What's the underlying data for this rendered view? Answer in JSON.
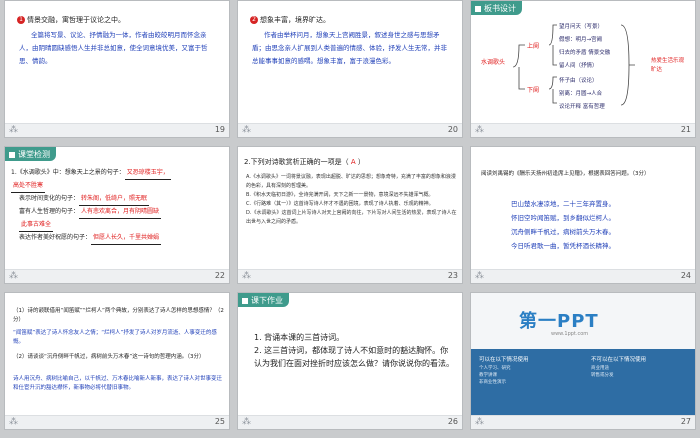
{
  "footer_star": "⁂",
  "slides": {
    "s19": {
      "num": "19",
      "heading_badge": "1",
      "heading": "情景交融，寓哲理于议论之中。",
      "body": "全篇将写景、议论、抒情融为一体，作者由皎皎明月而怀念亲人，由阴晴圆缺感悟人生并非总如意，使全词意境优美，又富于哲思、情韵。"
    },
    "s20": {
      "num": "20",
      "heading_badge": "2",
      "heading": "想象丰富，境界旷达。",
      "body": "作者由举杯问月，想象天上宫阙胜景，叙述身世之感与思想矛盾；由思念亲人扩展到人类普遍的情感、体验，抒发人生无常，并非总能事事如意的感喟。想象丰富，富于浪漫色彩。"
    },
    "s21": {
      "num": "21",
      "title": "板书设计",
      "root": "水调歌头",
      "upper": "上阕",
      "lower": "下阕",
      "upper_items": [
        "望月问天（写景）",
        "假想：明月→宫阙",
        "归去的矛盾  情景交融",
        "留人间（抒情）"
      ],
      "lower_items": [
        "怀子由（议论）",
        "别离：月圆→人合",
        "议论开释  富有哲理"
      ],
      "right": "热爱生活乐观旷达"
    },
    "s22": {
      "num": "22",
      "bar": "课堂检测",
      "q1_lead": "1.《水调歌头》中：想象天上之景的句子：",
      "q1_ans1": "又恐琼楼玉宇，",
      "q1_ans2": "高处不胜寒",
      "q2_lead": "表示时间变化的句子：",
      "q2_ans": "转朱阁，低绮户，照无眠",
      "q3_lead": "富有人生哲理的句子：",
      "q3_ans1": "人有悲欢离合，月有阴晴圆缺",
      "q3_ans2": "此事古难全",
      "q4_lead": "表达作者美好祝愿的句子：",
      "q4_ans": "但愿人长久，千里共婵娟"
    },
    "s23": {
      "num": "23",
      "question": "2.下列对诗歌赏析正确的一项是（ ",
      "answer": "A",
      "question_end": " ）",
      "options": [
        "A.《水调歌头》一词将景议融，表现出超脱、旷达的思想；想象奇特，充满了丰富的想象和浪漫的色彩，具有深刻的哲理美。",
        "B.《积水天临初日游》，全诗完满开阔，天下之新一一景物，意境深远不失雄浑气概。",
        "C.《行路难（其一）》这首诗写诗人怀才不遇的困境，表现了诗人执着、乐观的精神。",
        "D.《水调歌头》这首词上片写诗人对天上宫阙的向往，下片写对人间生活的热爱，表现了诗人在出世与入世之间的矛盾。"
      ]
    },
    "s24": {
      "num": "24",
      "question": "阅读刘禹锡的《酬乐天扬州初逢席上见赠》，根据表回答问题。（3分）",
      "lines": [
        "巴山楚水凄凉地，二十三年弃置身。",
        "怀旧空吟闻笛赋，到乡翻似烂柯人。",
        "沉舟侧畔千帆过，病树前头万木春。",
        "今日听君歌一曲，暂凭杯酒长精神。"
      ]
    },
    "s25": {
      "num": "25",
      "q1": "（1）诗的颔联借用“闻笛赋”“烂柯人”两个典故，分别表达了诗人怎样的思想感情？（2分）",
      "a1": "“闻笛赋”表达了诗人怀念友人之情；“烂柯人”抒发了诗人对岁月流逝、人事变迁的感慨。",
      "q2": "（2）请谈谈“沉舟侧畔千帆过，病树前头万木春”这一诗句的哲理内涵。（3分）",
      "a2": "诗人用沉舟、病树比喻自己，以千帆过、万木春比喻新人新事，表达了诗人对世事变迁和仕宦升沉的豁达襟怀，新事物必将代替旧事物。"
    },
    "s26": {
      "num": "26",
      "bar": "课下作业",
      "item1": "1. 背诵本课的三首诗词。",
      "item2": "2. 这三首诗词，都体现了诗人不如意时的豁达胸怀。你认为我们在面对挫折时应该怎么做？请你说说你的看法。"
    },
    "s27": {
      "num": "27",
      "logo": "第一PPT",
      "url": "www.1ppt.com",
      "left_title": "可以在以下情况使用",
      "right_title": "不可以在以下情况使用",
      "left_items": [
        "个人学习、研究",
        "教学讲课",
        "非商业性演示"
      ],
      "right_items": [
        "商业用途",
        "转售或分发"
      ]
    }
  }
}
